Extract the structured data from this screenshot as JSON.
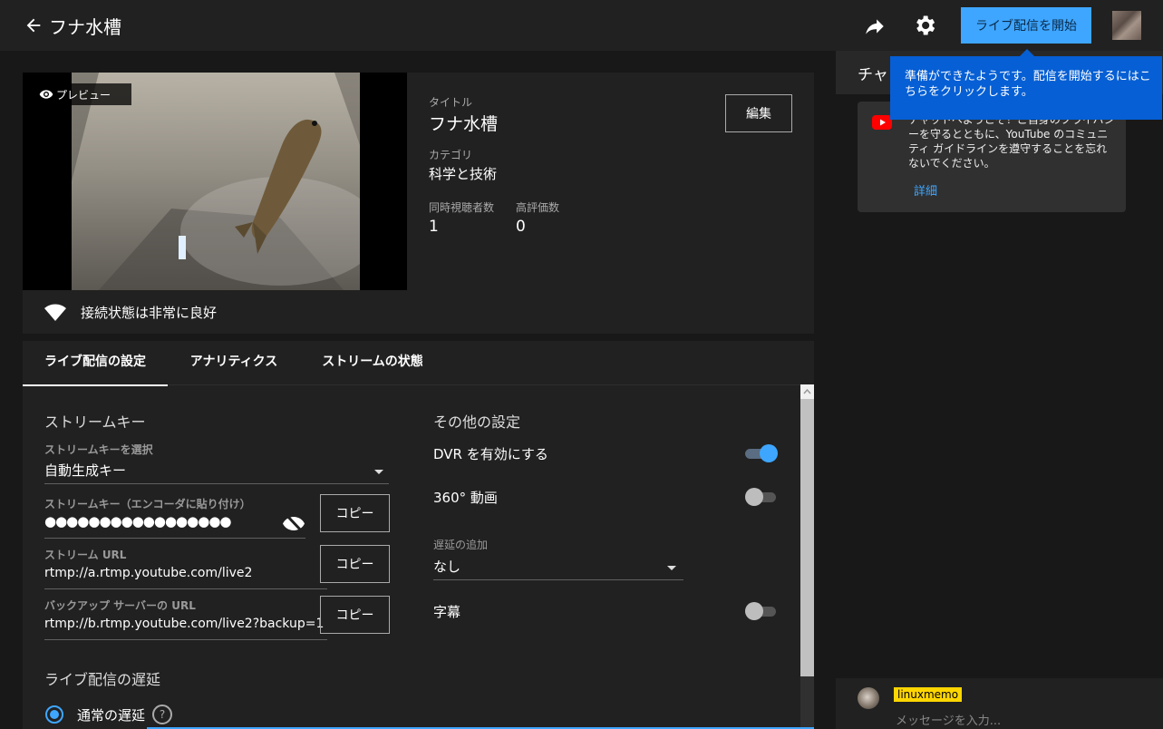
{
  "header": {
    "title": "フナ水槽",
    "go_live_label": "ライブ配信を開始"
  },
  "tooltip": {
    "text": "準備ができたようです。配信を開始するにはこちらをクリックします。"
  },
  "preview": {
    "badge_label": "プレビュー",
    "title_label": "タイトル",
    "title_value": "フナ水槽",
    "edit_label": "編集",
    "category_label": "カテゴリ",
    "category_value": "科学と技術",
    "viewers_label": "同時視聴者数",
    "viewers_value": "1",
    "likes_label": "高評価数",
    "likes_value": "0",
    "connection_text": "接続状態は非常に良好"
  },
  "tabs": [
    {
      "label": "ライブ配信の設定",
      "active": true
    },
    {
      "label": "アナリティクス",
      "active": false
    },
    {
      "label": "ストリームの状態",
      "active": false
    }
  ],
  "stream": {
    "section_title": "ストリームキー",
    "select_label": "ストリームキーを選択",
    "select_value": "自動生成キー",
    "key_label": "ストリームキー（エンコーダに貼り付け）",
    "key_value": "●●●●●●●●●●●●●●●●●",
    "url_label": "ストリーム URL",
    "url_value": "rtmp://a.rtmp.youtube.com/live2",
    "backup_label": "バックアップ サーバーの URL",
    "backup_value": "rtmp://b.rtmp.youtube.com/live2?backup=1",
    "copy_label": "コピー",
    "latency_title": "ライブ配信の遅延",
    "latency_option": "通常の遅延",
    "help_glyph": "?"
  },
  "other": {
    "section_title": "その他の設定",
    "dvr_label": "DVR を有効にする",
    "dvr_on": true,
    "video360_label": "360° 動画",
    "video360_on": false,
    "delay_label": "遅延の追加",
    "delay_value": "なし",
    "captions_label": "字幕",
    "captions_on": false
  },
  "chat": {
    "header": "チャ",
    "welcome_text": "チャットへようこそ！ご自身のプライバシーを守るとともに、YouTube のコミュニティ ガイドラインを遵守することを忘れないでください。",
    "welcome_link": "詳細",
    "username": "linuxmemo",
    "placeholder": "メッセージを入力..."
  },
  "colors": {
    "accent": "#3ea6ff",
    "tooltip_bg": "#065fd4",
    "badge_yellow": "#ffd600"
  }
}
